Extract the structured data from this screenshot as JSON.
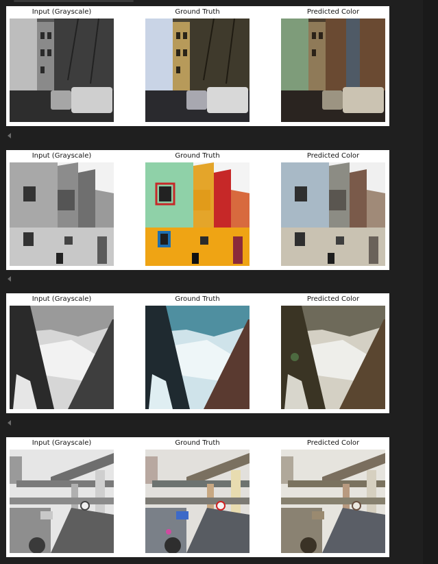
{
  "titles": {
    "input": "Input (Grayscale)",
    "truth": "Ground Truth",
    "predicted": "Predicted Color"
  },
  "rows": [
    {
      "scene": "street with parked cars and bare trees"
    },
    {
      "scene": "colorful wooden building facade"
    },
    {
      "scene": "snowy mountain valley between cliffs"
    },
    {
      "scene": "city street under elevated overpass"
    }
  ]
}
